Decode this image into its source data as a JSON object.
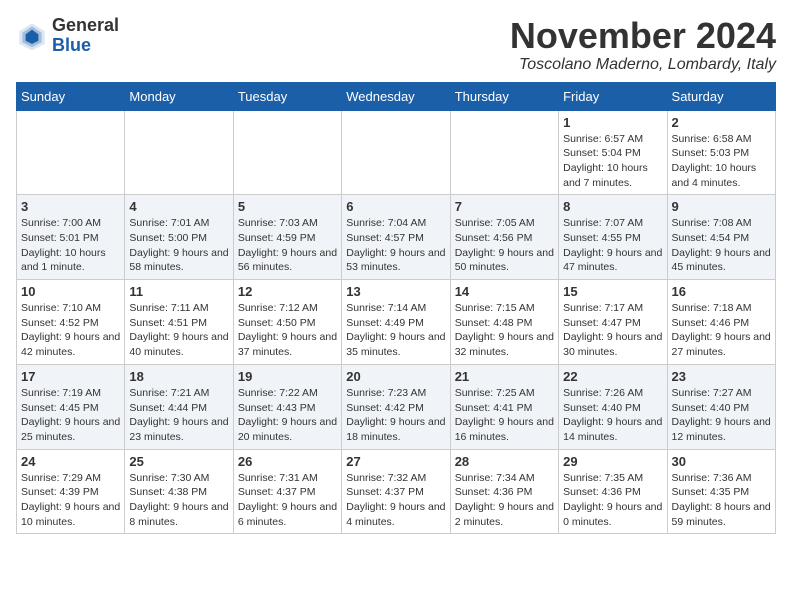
{
  "header": {
    "logo_line1": "General",
    "logo_line2": "Blue",
    "month_title": "November 2024",
    "location": "Toscolano Maderno, Lombardy, Italy"
  },
  "days_of_week": [
    "Sunday",
    "Monday",
    "Tuesday",
    "Wednesday",
    "Thursday",
    "Friday",
    "Saturday"
  ],
  "weeks": [
    [
      {
        "day": "",
        "info": ""
      },
      {
        "day": "",
        "info": ""
      },
      {
        "day": "",
        "info": ""
      },
      {
        "day": "",
        "info": ""
      },
      {
        "day": "",
        "info": ""
      },
      {
        "day": "1",
        "info": "Sunrise: 6:57 AM\nSunset: 5:04 PM\nDaylight: 10 hours and 7 minutes."
      },
      {
        "day": "2",
        "info": "Sunrise: 6:58 AM\nSunset: 5:03 PM\nDaylight: 10 hours and 4 minutes."
      }
    ],
    [
      {
        "day": "3",
        "info": "Sunrise: 7:00 AM\nSunset: 5:01 PM\nDaylight: 10 hours and 1 minute."
      },
      {
        "day": "4",
        "info": "Sunrise: 7:01 AM\nSunset: 5:00 PM\nDaylight: 9 hours and 58 minutes."
      },
      {
        "day": "5",
        "info": "Sunrise: 7:03 AM\nSunset: 4:59 PM\nDaylight: 9 hours and 56 minutes."
      },
      {
        "day": "6",
        "info": "Sunrise: 7:04 AM\nSunset: 4:57 PM\nDaylight: 9 hours and 53 minutes."
      },
      {
        "day": "7",
        "info": "Sunrise: 7:05 AM\nSunset: 4:56 PM\nDaylight: 9 hours and 50 minutes."
      },
      {
        "day": "8",
        "info": "Sunrise: 7:07 AM\nSunset: 4:55 PM\nDaylight: 9 hours and 47 minutes."
      },
      {
        "day": "9",
        "info": "Sunrise: 7:08 AM\nSunset: 4:54 PM\nDaylight: 9 hours and 45 minutes."
      }
    ],
    [
      {
        "day": "10",
        "info": "Sunrise: 7:10 AM\nSunset: 4:52 PM\nDaylight: 9 hours and 42 minutes."
      },
      {
        "day": "11",
        "info": "Sunrise: 7:11 AM\nSunset: 4:51 PM\nDaylight: 9 hours and 40 minutes."
      },
      {
        "day": "12",
        "info": "Sunrise: 7:12 AM\nSunset: 4:50 PM\nDaylight: 9 hours and 37 minutes."
      },
      {
        "day": "13",
        "info": "Sunrise: 7:14 AM\nSunset: 4:49 PM\nDaylight: 9 hours and 35 minutes."
      },
      {
        "day": "14",
        "info": "Sunrise: 7:15 AM\nSunset: 4:48 PM\nDaylight: 9 hours and 32 minutes."
      },
      {
        "day": "15",
        "info": "Sunrise: 7:17 AM\nSunset: 4:47 PM\nDaylight: 9 hours and 30 minutes."
      },
      {
        "day": "16",
        "info": "Sunrise: 7:18 AM\nSunset: 4:46 PM\nDaylight: 9 hours and 27 minutes."
      }
    ],
    [
      {
        "day": "17",
        "info": "Sunrise: 7:19 AM\nSunset: 4:45 PM\nDaylight: 9 hours and 25 minutes."
      },
      {
        "day": "18",
        "info": "Sunrise: 7:21 AM\nSunset: 4:44 PM\nDaylight: 9 hours and 23 minutes."
      },
      {
        "day": "19",
        "info": "Sunrise: 7:22 AM\nSunset: 4:43 PM\nDaylight: 9 hours and 20 minutes."
      },
      {
        "day": "20",
        "info": "Sunrise: 7:23 AM\nSunset: 4:42 PM\nDaylight: 9 hours and 18 minutes."
      },
      {
        "day": "21",
        "info": "Sunrise: 7:25 AM\nSunset: 4:41 PM\nDaylight: 9 hours and 16 minutes."
      },
      {
        "day": "22",
        "info": "Sunrise: 7:26 AM\nSunset: 4:40 PM\nDaylight: 9 hours and 14 minutes."
      },
      {
        "day": "23",
        "info": "Sunrise: 7:27 AM\nSunset: 4:40 PM\nDaylight: 9 hours and 12 minutes."
      }
    ],
    [
      {
        "day": "24",
        "info": "Sunrise: 7:29 AM\nSunset: 4:39 PM\nDaylight: 9 hours and 10 minutes."
      },
      {
        "day": "25",
        "info": "Sunrise: 7:30 AM\nSunset: 4:38 PM\nDaylight: 9 hours and 8 minutes."
      },
      {
        "day": "26",
        "info": "Sunrise: 7:31 AM\nSunset: 4:37 PM\nDaylight: 9 hours and 6 minutes."
      },
      {
        "day": "27",
        "info": "Sunrise: 7:32 AM\nSunset: 4:37 PM\nDaylight: 9 hours and 4 minutes."
      },
      {
        "day": "28",
        "info": "Sunrise: 7:34 AM\nSunset: 4:36 PM\nDaylight: 9 hours and 2 minutes."
      },
      {
        "day": "29",
        "info": "Sunrise: 7:35 AM\nSunset: 4:36 PM\nDaylight: 9 hours and 0 minutes."
      },
      {
        "day": "30",
        "info": "Sunrise: 7:36 AM\nSunset: 4:35 PM\nDaylight: 8 hours and 59 minutes."
      }
    ]
  ]
}
